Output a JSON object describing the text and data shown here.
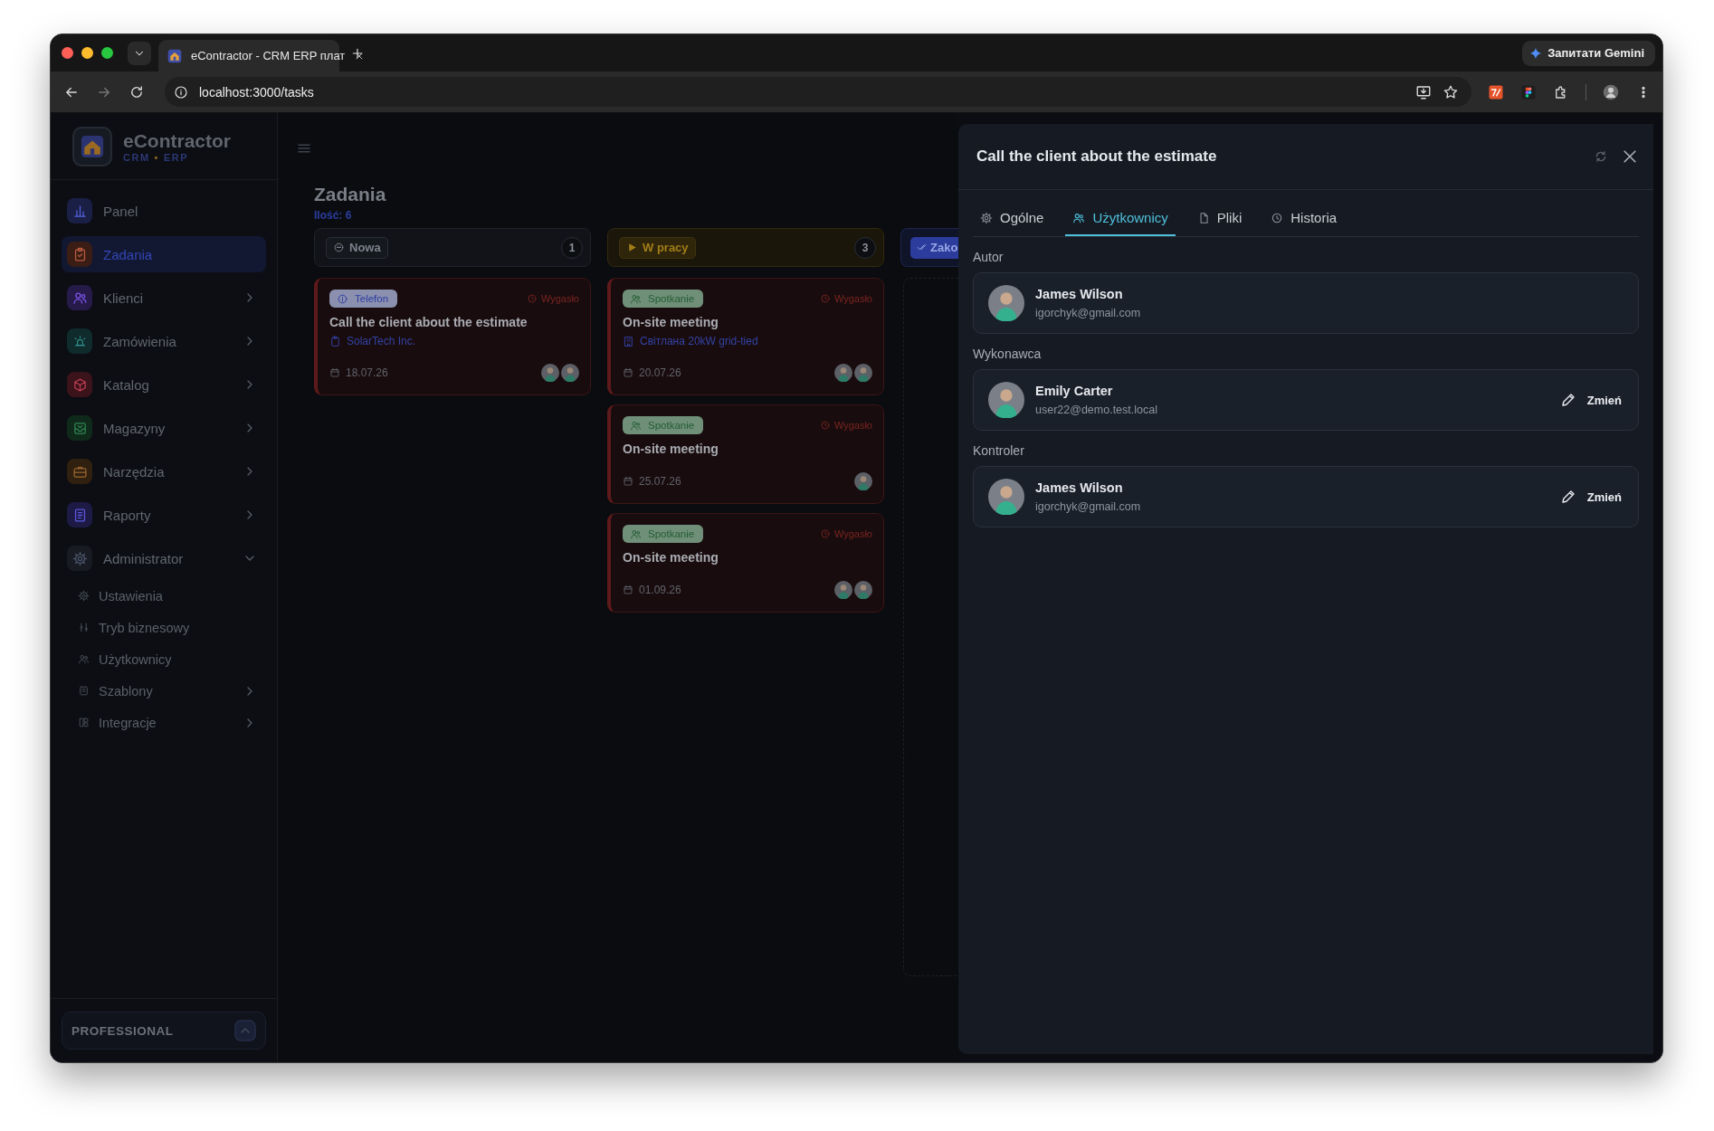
{
  "browser": {
    "tab_title": "eContractor - CRM ERP плат",
    "url": "localhost:3000/tasks",
    "gemini_button": "Запитати Gemini"
  },
  "sidebar": {
    "brand": "eContractor",
    "tagline": {
      "left": "CRM",
      "separator": "•",
      "right": "ERP"
    },
    "items": [
      {
        "label": "Panel",
        "color": "#1a1f45",
        "selected": false
      },
      {
        "label": "Zadania",
        "color": "#3a1d14",
        "selected": true
      },
      {
        "label": "Klienci",
        "color": "#261a48",
        "selected": false,
        "expanded": false
      },
      {
        "label": "Zamówienia",
        "color": "#0f2b2b",
        "selected": false,
        "expanded": false
      },
      {
        "label": "Katalog",
        "color": "#3b131a",
        "selected": false,
        "expanded": false
      },
      {
        "label": "Magazyny",
        "color": "#0f2a1a",
        "selected": false,
        "expanded": false
      },
      {
        "label": "Narzędzia",
        "color": "#30200f",
        "selected": false,
        "expanded": false
      },
      {
        "label": "Raporty",
        "color": "#1d1b46",
        "selected": false,
        "expanded": false
      },
      {
        "label": "Administrator",
        "color": "#181b22",
        "selected": false,
        "expanded": true,
        "children": [
          {
            "label": "Ustawienia",
            "selected": false
          },
          {
            "label": "Tryb biznesowy",
            "selected": false
          },
          {
            "label": "Użytkownicy",
            "selected": false
          },
          {
            "label": "Szablony",
            "selected": false,
            "expanded": false
          },
          {
            "label": "Integracje",
            "selected": false,
            "expanded": false
          }
        ]
      }
    ],
    "plan": "PROFESSIONAL"
  },
  "board": {
    "title": "Zadania",
    "count": "Ilość: 6",
    "columns": [
      {
        "label": "Nowa",
        "kind": "new",
        "count": "1",
        "cards": [
          {
            "type": {
              "label": "Telefon",
              "kind": "phone"
            },
            "status": {
              "label": "Wygasło",
              "kind": "expired"
            },
            "title": "Call the client about the estimate",
            "link": {
              "label": "SolarTech Inc.",
              "kind": "client"
            },
            "date": "18.07.26",
            "assignees": [
              {
                "kind": "photo"
              },
              {
                "kind": "photo"
              }
            ]
          }
        ]
      },
      {
        "label": "W pracy",
        "kind": "in_progress",
        "count": "3",
        "cards": [
          {
            "type": {
              "label": "Spotkanie",
              "kind": "meeting"
            },
            "status": {
              "label": "Wygasło",
              "kind": "expired"
            },
            "title": "On-site meeting",
            "link": {
              "label": "Світлана 20kW grid-tied",
              "kind": "order"
            },
            "date": "20.07.26",
            "assignees": [
              {
                "kind": "photo"
              },
              {
                "kind": "photo"
              }
            ]
          },
          {
            "type": {
              "label": "Spotkanie",
              "kind": "meeting"
            },
            "status": {
              "label": "Wygasło",
              "kind": "expired"
            },
            "title": "On-site meeting",
            "date": "25.07.26",
            "assignees": [
              {
                "kind": "photo"
              }
            ]
          },
          {
            "type": {
              "label": "Spotkanie",
              "kind": "meeting"
            },
            "status": {
              "label": "Wygasło",
              "kind": "expired"
            },
            "title": "On-site meeting",
            "date": "01.09.26",
            "assignees": [
              {
                "kind": "photo"
              },
              {
                "kind": "photo"
              }
            ]
          }
        ]
      },
      {
        "label": "Zako",
        "kind": "done"
      }
    ]
  },
  "drawer": {
    "title": "Call the client about the estimate",
    "tabs": [
      {
        "label": "Ogólne",
        "selected": false
      },
      {
        "label": "Użytkownicy",
        "selected": true
      },
      {
        "label": "Pliki",
        "selected": false
      },
      {
        "label": "Historia",
        "selected": false
      }
    ],
    "sections": [
      {
        "heading": "Autor",
        "name": "James Wilson",
        "email": "igorchyk@gmail.com"
      },
      {
        "heading": "Wykonawca",
        "name": "Emily Carter",
        "email": "user22@demo.test.local",
        "action": "Zmień"
      },
      {
        "heading": "Kontroler",
        "name": "James Wilson",
        "email": "igorchyk@gmail.com",
        "action": "Zmień"
      }
    ]
  }
}
